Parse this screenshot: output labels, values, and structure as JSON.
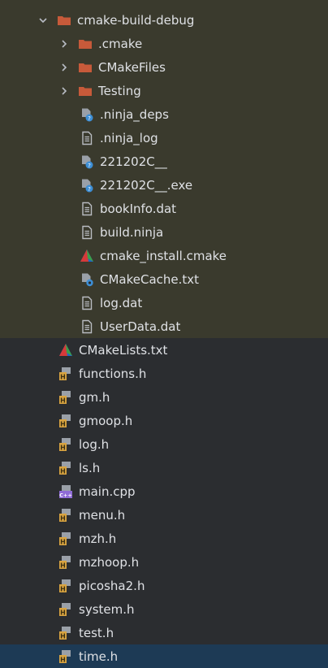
{
  "colors": {
    "background": "#2b2d30",
    "excluded_background": "#3a3a2d",
    "selected_background": "#1d3a55",
    "folder": "#c75a3a",
    "text": "#dfe1e5"
  },
  "tree": {
    "rows": [
      {
        "label": "cmake-build-debug",
        "icon": "folder-icon",
        "chevron": "chevron-down-icon",
        "depth": 0,
        "excluded": true
      },
      {
        "label": ".cmake",
        "icon": "folder-icon",
        "chevron": "chevron-right-icon",
        "depth": 1,
        "excluded": true
      },
      {
        "label": "CMakeFiles",
        "icon": "folder-icon",
        "chevron": "chevron-right-icon",
        "depth": 1,
        "excluded": true
      },
      {
        "label": "Testing",
        "icon": "folder-icon",
        "chevron": "chevron-right-icon",
        "depth": 1,
        "excluded": true
      },
      {
        "label": ".ninja_deps",
        "icon": "unknown-file-icon",
        "chevron": "",
        "depth": 1,
        "excluded": true
      },
      {
        "label": ".ninja_log",
        "icon": "text-file-icon",
        "chevron": "",
        "depth": 1,
        "excluded": true
      },
      {
        "label": "221202C__",
        "icon": "unknown-file-icon",
        "chevron": "",
        "depth": 1,
        "excluded": true
      },
      {
        "label": "221202C__.exe",
        "icon": "unknown-file-icon",
        "chevron": "",
        "depth": 1,
        "excluded": true
      },
      {
        "label": "bookInfo.dat",
        "icon": "text-file-icon",
        "chevron": "",
        "depth": 1,
        "excluded": true
      },
      {
        "label": "build.ninja",
        "icon": "text-file-icon",
        "chevron": "",
        "depth": 1,
        "excluded": true
      },
      {
        "label": "cmake_install.cmake",
        "icon": "cmake-icon",
        "chevron": "",
        "depth": 1,
        "excluded": true
      },
      {
        "label": "CMakeCache.txt",
        "icon": "cmake-cache-icon",
        "chevron": "",
        "depth": 1,
        "excluded": true
      },
      {
        "label": "log.dat",
        "icon": "text-file-icon",
        "chevron": "",
        "depth": 1,
        "excluded": true
      },
      {
        "label": "UserData.dat",
        "icon": "text-file-icon",
        "chevron": "",
        "depth": 1,
        "excluded": true
      },
      {
        "label": "CMakeLists.txt",
        "icon": "cmake-icon",
        "chevron": "",
        "depth": 0,
        "excluded": false
      },
      {
        "label": "functions.h",
        "icon": "header-file-icon",
        "chevron": "",
        "depth": 0,
        "excluded": false
      },
      {
        "label": "gm.h",
        "icon": "header-file-icon",
        "chevron": "",
        "depth": 0,
        "excluded": false
      },
      {
        "label": "gmoop.h",
        "icon": "header-file-icon",
        "chevron": "",
        "depth": 0,
        "excluded": false
      },
      {
        "label": "log.h",
        "icon": "header-file-icon",
        "chevron": "",
        "depth": 0,
        "excluded": false
      },
      {
        "label": "ls.h",
        "icon": "header-file-icon",
        "chevron": "",
        "depth": 0,
        "excluded": false
      },
      {
        "label": "main.cpp",
        "icon": "cpp-file-icon",
        "chevron": "",
        "depth": 0,
        "excluded": false
      },
      {
        "label": "menu.h",
        "icon": "header-file-icon",
        "chevron": "",
        "depth": 0,
        "excluded": false
      },
      {
        "label": "mzh.h",
        "icon": "header-file-icon",
        "chevron": "",
        "depth": 0,
        "excluded": false
      },
      {
        "label": "mzhoop.h",
        "icon": "header-file-icon",
        "chevron": "",
        "depth": 0,
        "excluded": false
      },
      {
        "label": "picosha2.h",
        "icon": "header-file-icon",
        "chevron": "",
        "depth": 0,
        "excluded": false
      },
      {
        "label": "system.h",
        "icon": "header-file-icon",
        "chevron": "",
        "depth": 0,
        "excluded": false
      },
      {
        "label": "test.h",
        "icon": "header-file-icon",
        "chevron": "",
        "depth": 0,
        "excluded": false
      },
      {
        "label": "time.h",
        "icon": "header-file-icon",
        "chevron": "",
        "depth": 0,
        "excluded": false,
        "selected": true
      }
    ]
  }
}
